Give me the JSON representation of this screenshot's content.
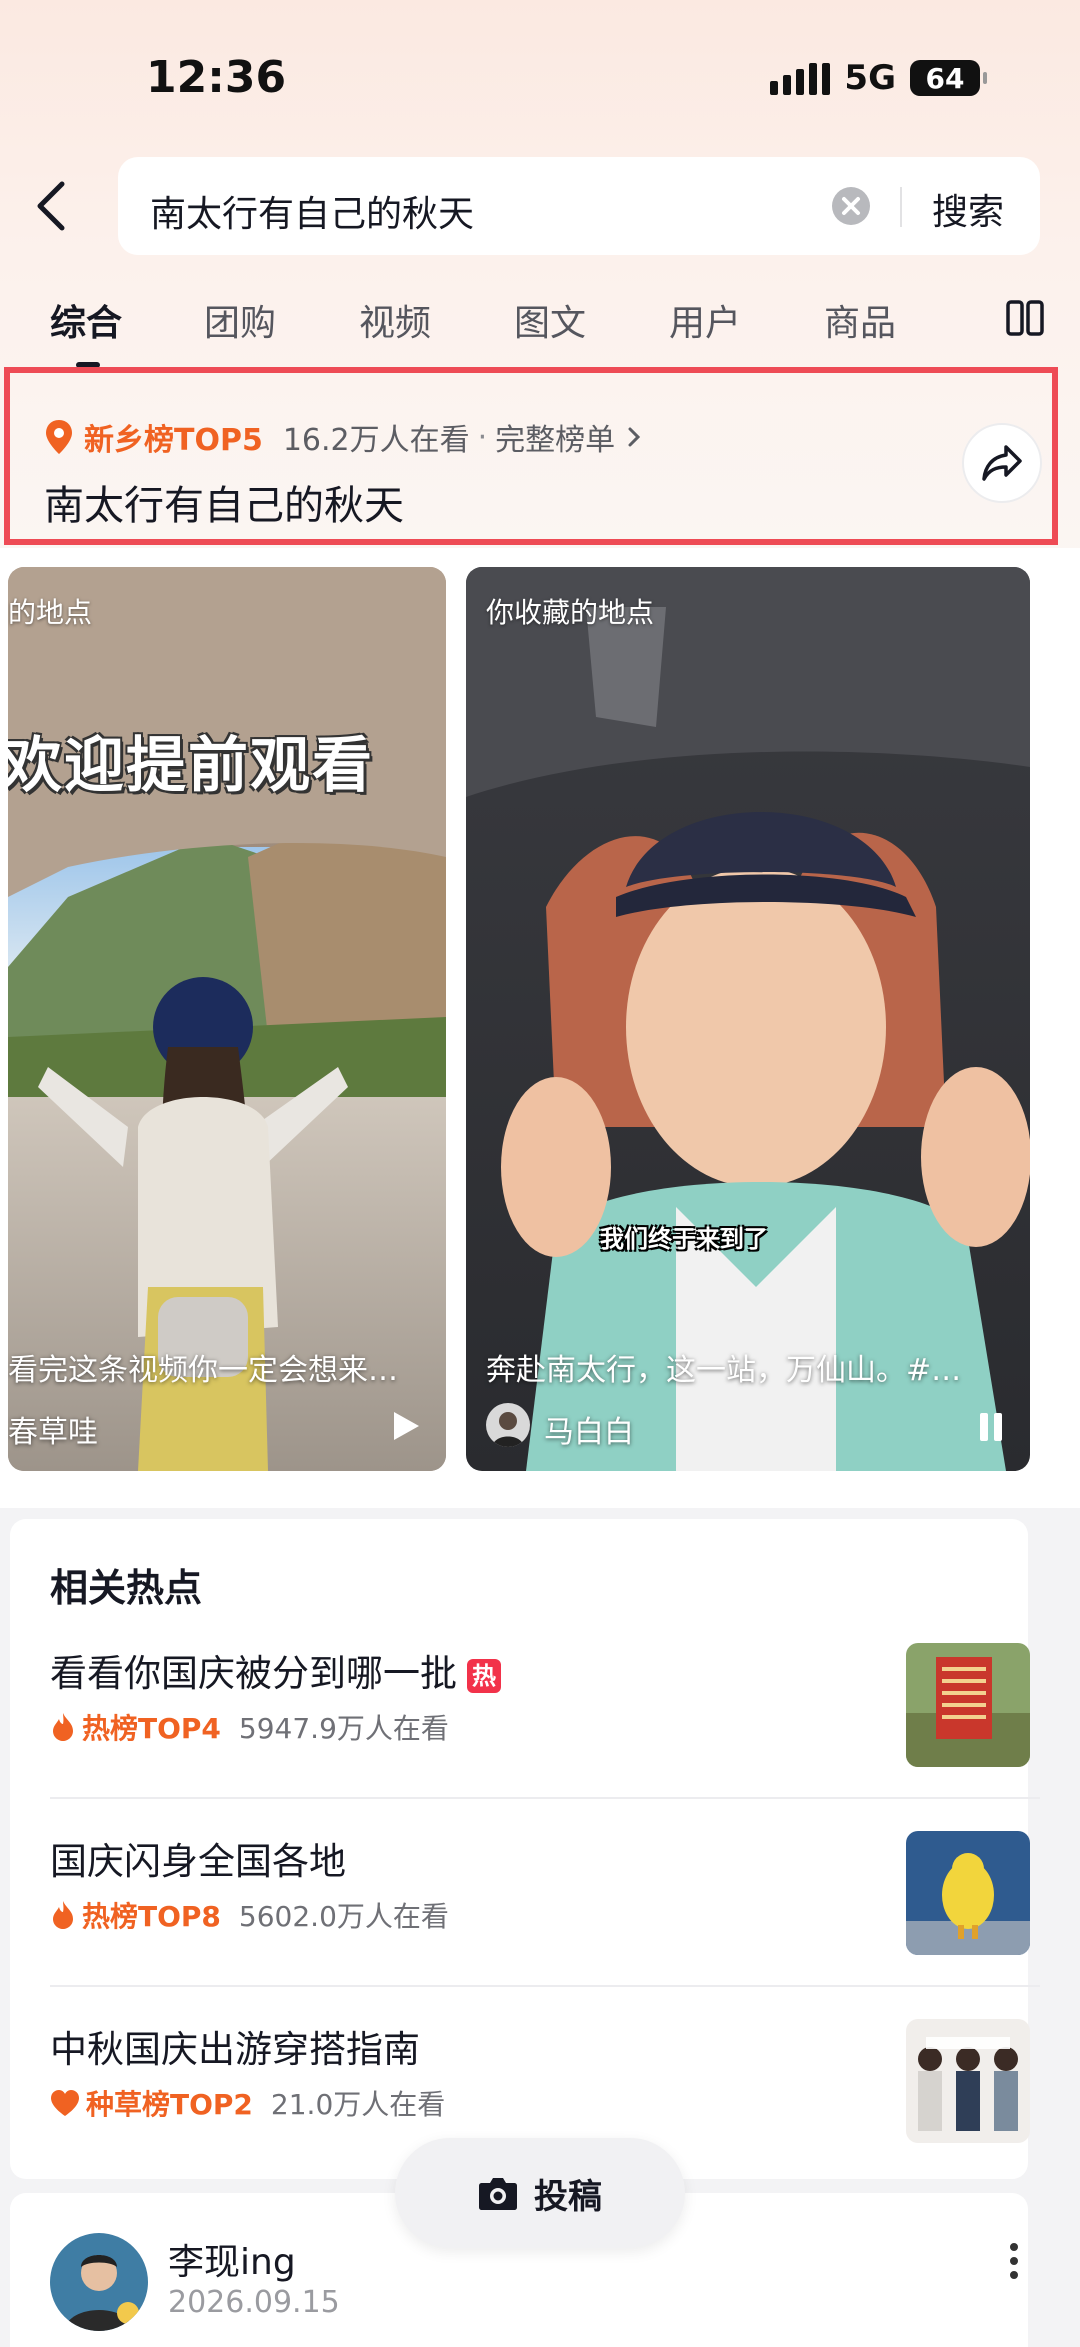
{
  "status": {
    "time": "12:36",
    "network": "5G",
    "battery": "64"
  },
  "search": {
    "query": "南太行有自己的秋天",
    "button": "搜索"
  },
  "tabs": [
    {
      "label": "综合",
      "active": true
    },
    {
      "label": "团购"
    },
    {
      "label": "视频"
    },
    {
      "label": "图文"
    },
    {
      "label": "用户"
    },
    {
      "label": "商品"
    }
  ],
  "rank_card": {
    "tag": "新乡榜TOP5",
    "watching": "16.2万人在看",
    "full_list": "完整榜单",
    "title": "南太行有自己的秋天"
  },
  "videos": [
    {
      "location_tag": "的地点",
      "overlay_text": "欢迎提前观看",
      "desc": "看完这条视频你一定会想来…",
      "author": "春草哇"
    },
    {
      "location_tag": "你收藏的地点",
      "subtitle": "我们终于来到了",
      "desc": "奔赴南太行，这一站，万仙山。#…",
      "author": "马白白"
    }
  ],
  "hot_section": {
    "title": "相关热点",
    "items": [
      {
        "title": "看看你国庆被分到哪一批",
        "badge": "热",
        "rank": "热榜TOP4",
        "rank_color": "#f06222",
        "count": "5947.9万人在看"
      },
      {
        "title": "国庆闪身全国各地",
        "rank": "热榜TOP8",
        "rank_color": "#f06222",
        "count": "5602.0万人在看"
      },
      {
        "title": "中秋国庆出游穿搭指南",
        "rank": "种草榜TOP2",
        "rank_color": "#f06222",
        "count": "21.0万人在看"
      }
    ]
  },
  "post_button": {
    "label": "投稿"
  },
  "author_row": {
    "name": "李现ing",
    "date": "2026.09.15"
  },
  "colors": {
    "accent": "#f06222",
    "highlight_border": "#ee4b55",
    "hot_badge": "#f2324a"
  }
}
